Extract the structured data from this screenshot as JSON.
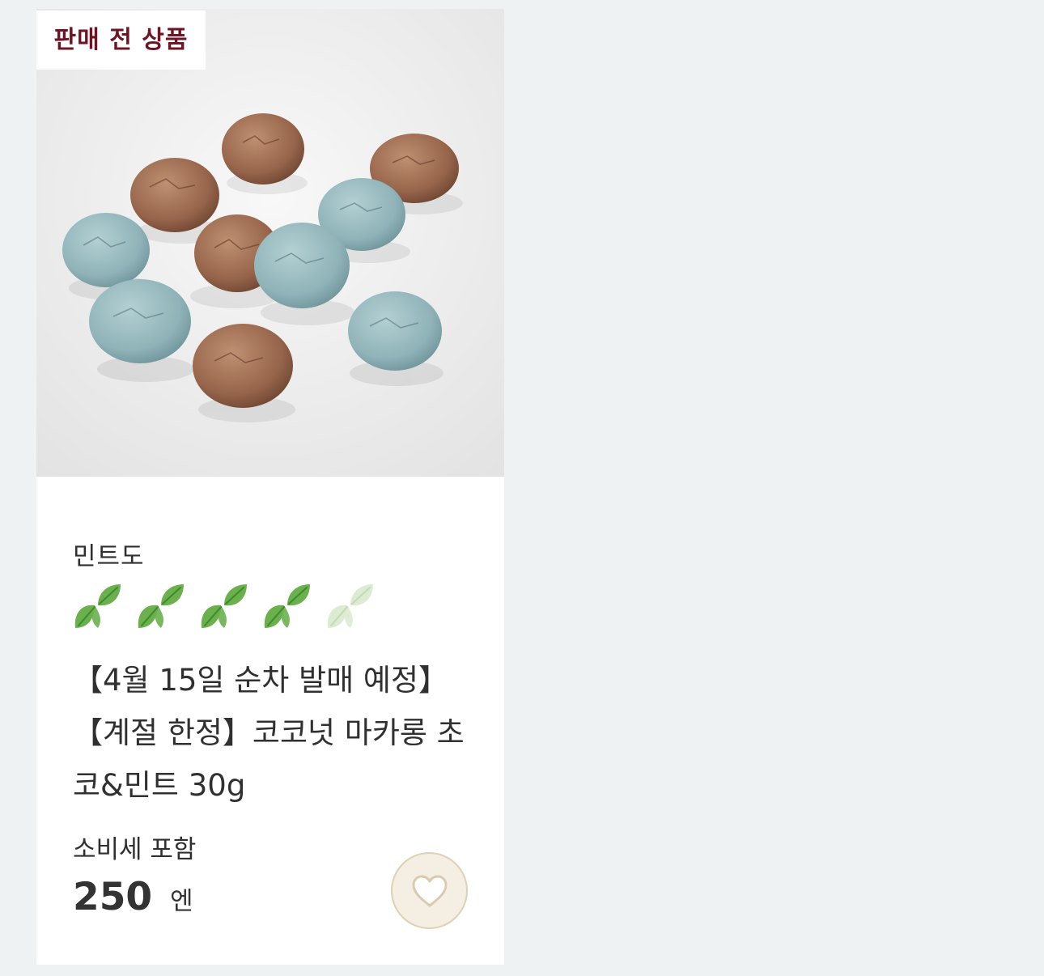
{
  "card": {
    "badge": "판매 전 상품",
    "image_alt": "코코넛 마카롱 초코&민트",
    "mint_label": "민트도",
    "mint_rating": {
      "value": 4,
      "max": 5,
      "icon": "mint-leaf-icon",
      "filled_color": "#6ab04c",
      "empty_color": "#dcebd2"
    },
    "title": "【4월 15일 순차 발매 예정】【계절 한정】코코넛 마카롱 초코&민트 30g",
    "tax_label": "소비세 포함",
    "price": "250",
    "currency": "엔",
    "favorite_icon": "heart-icon",
    "colors": {
      "badge_text": "#6e1424",
      "favorite_bg": "#f4eee3",
      "page_bg": "#eef2f3"
    }
  }
}
